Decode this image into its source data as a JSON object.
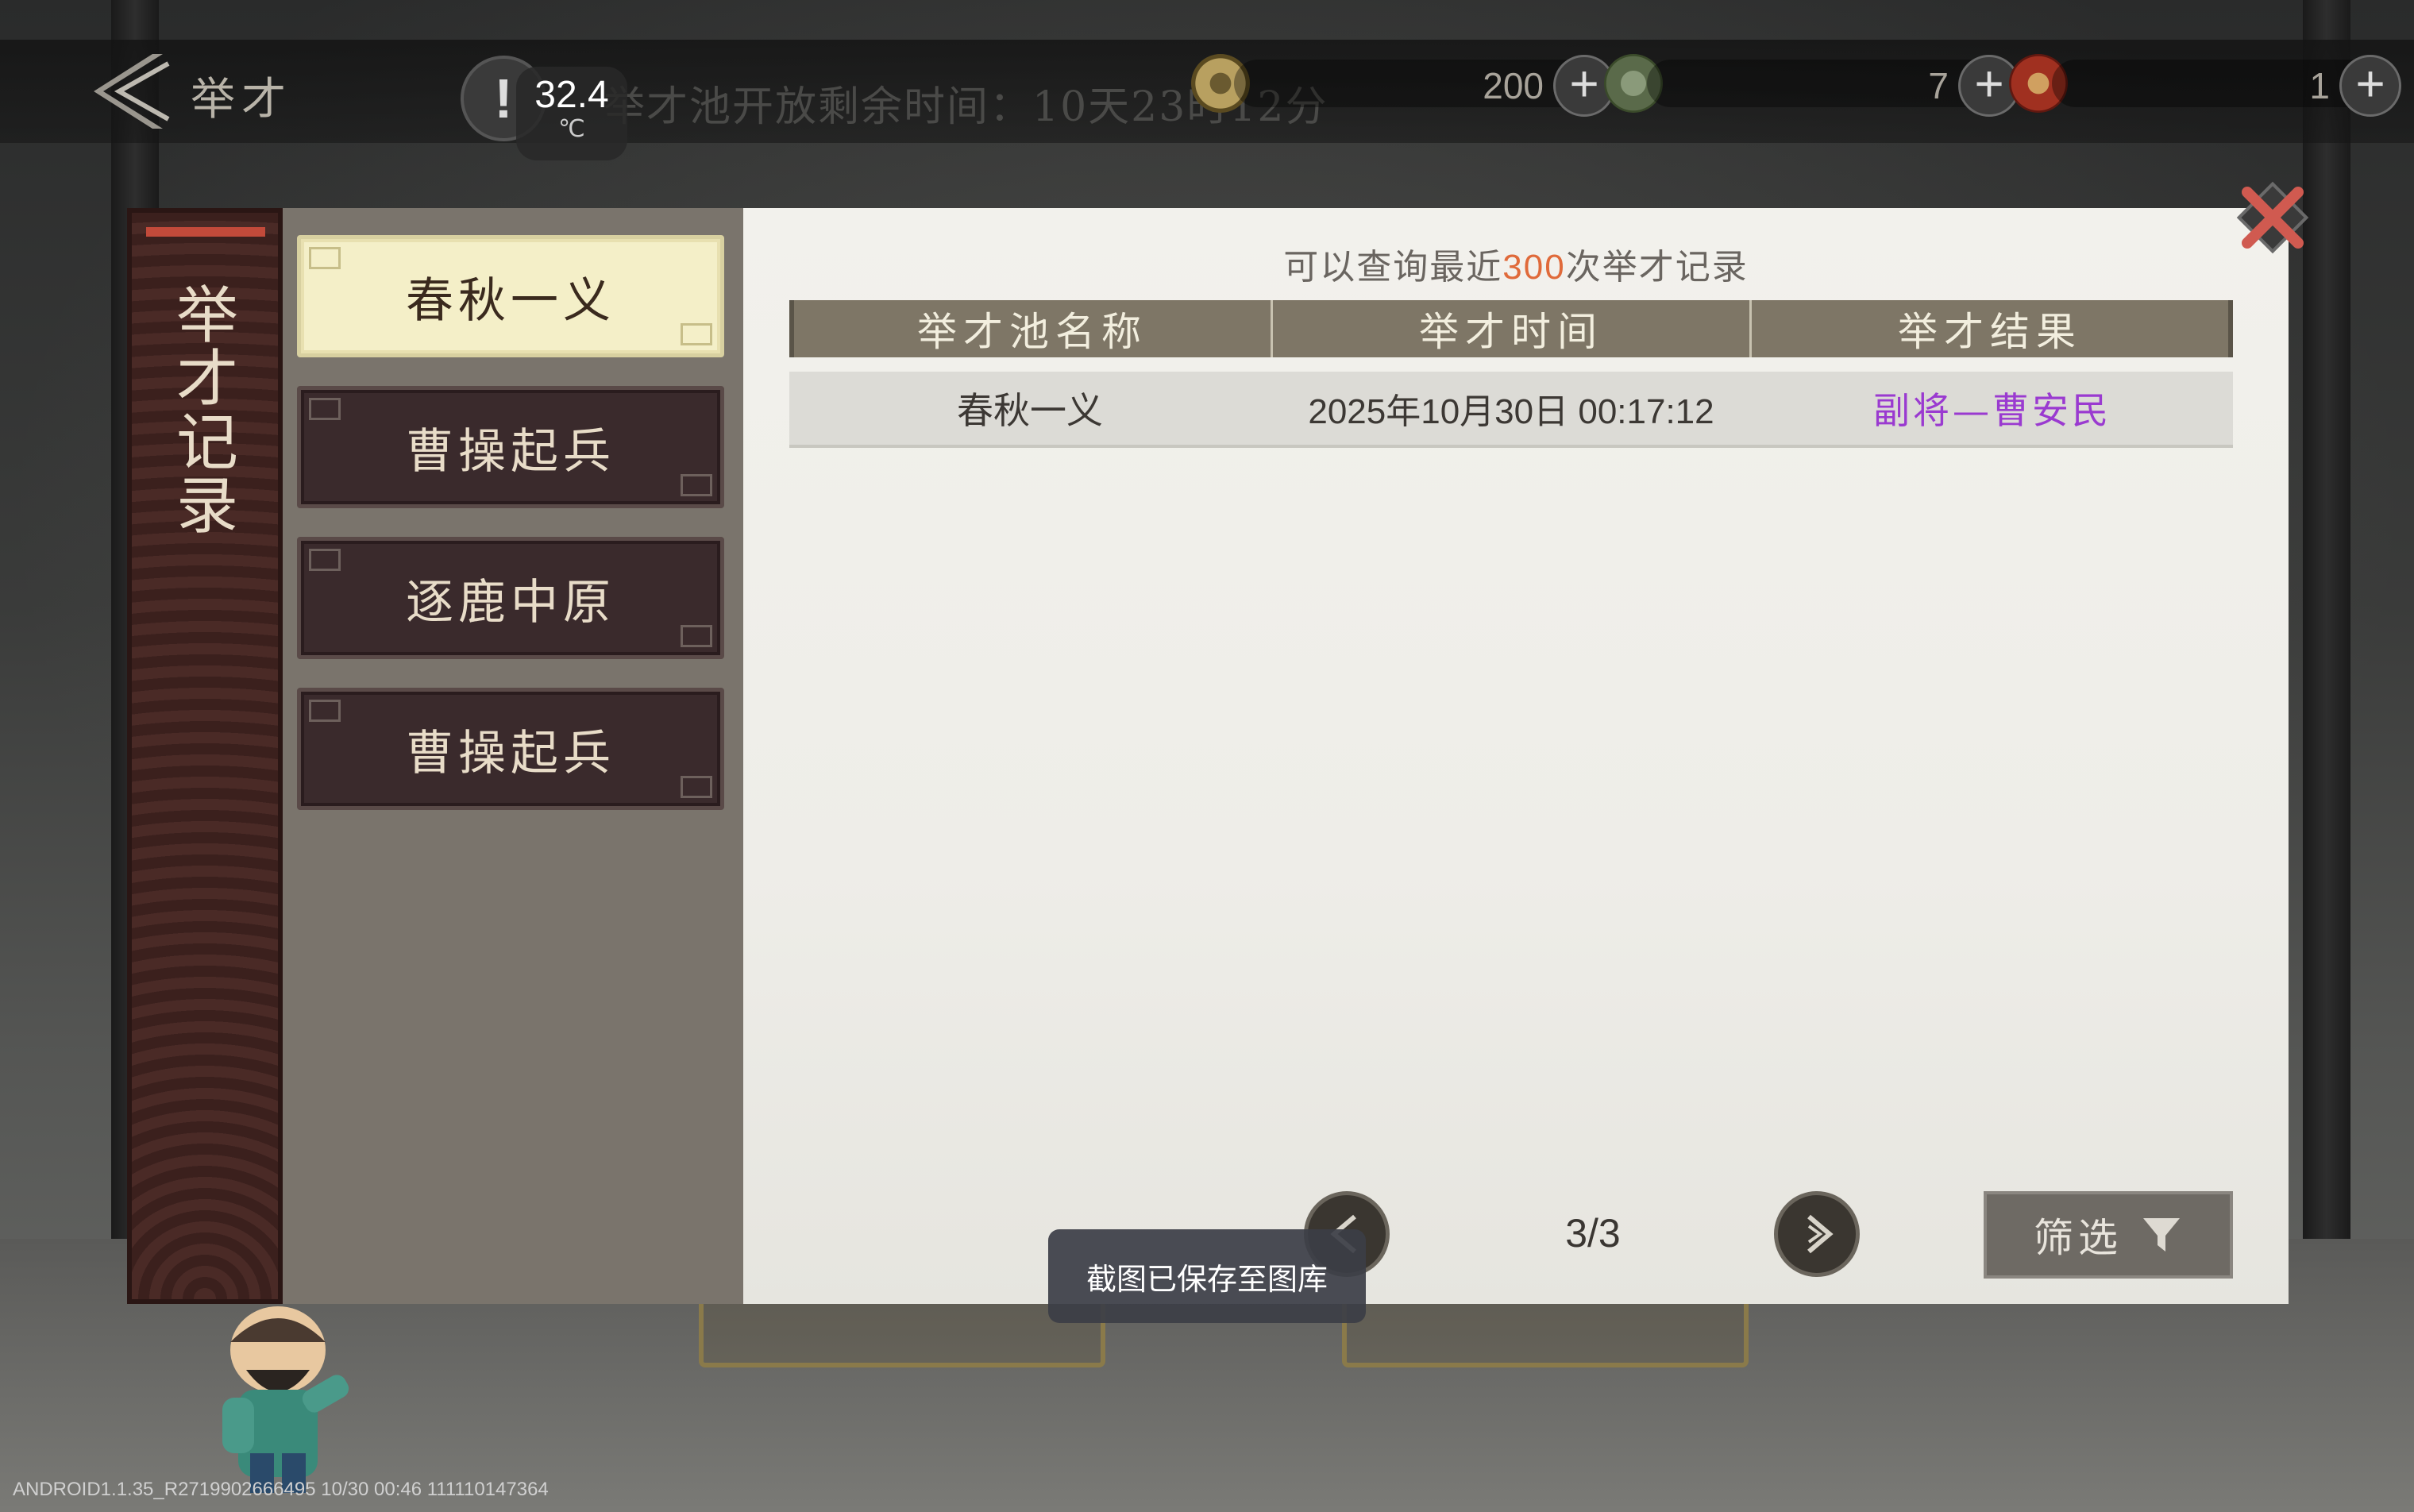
{
  "topbar": {
    "title": "举才",
    "warning_symbol": "!",
    "temperature": "32.4",
    "temperature_unit": "℃",
    "open_time_text": "举才池开放剩余时间：10天23时12分",
    "resources": [
      {
        "icon": "coin-icon",
        "value": "200"
      },
      {
        "icon": "jade-token-icon",
        "value": "7"
      },
      {
        "icon": "seal-token-icon",
        "value": "1"
      }
    ],
    "plus_label": "+"
  },
  "sidebar": {
    "title_chars": [
      "举",
      "才",
      "记",
      "录"
    ]
  },
  "tabs": [
    {
      "label": "春秋一义",
      "active": true
    },
    {
      "label": "曹操起兵",
      "active": false
    },
    {
      "label": "逐鹿中原",
      "active": false
    },
    {
      "label": "曹操起兵",
      "active": false
    }
  ],
  "records": {
    "hint_prefix": "可以查询最近",
    "hint_number": "300",
    "hint_suffix": "次举才记录",
    "columns": [
      "举才池名称",
      "举才时间",
      "举才结果"
    ],
    "rows": [
      {
        "pool": "春秋一义",
        "time": "2025年10月30日 00:17:12",
        "result": "副将—曹安民"
      }
    ]
  },
  "pagination": {
    "text": "3/3"
  },
  "filter_label": "筛选",
  "toast_text": "截图已保存至图库",
  "footer_info": "ANDROID1.1.35_R2719902666495 10/30 00:46 111110147364",
  "colors": {
    "accent_number": "#e06a3a",
    "result_purple": "#9a3ad0",
    "active_tab": "#f4efc8",
    "tab_dark": "#3a2a2c",
    "table_header": "#7e7666",
    "close_red": "#d05a50"
  }
}
